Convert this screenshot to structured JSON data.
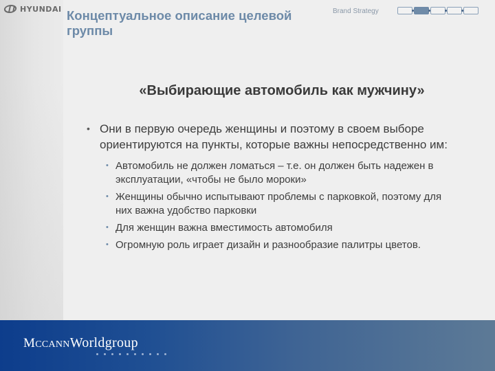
{
  "header": {
    "logo_text": "HYUNDAI",
    "title": "Концептуальное описание целевой группы",
    "brand_label": "Brand Strategy",
    "nav_step_count": 5,
    "nav_active_step": 2
  },
  "main": {
    "heading": "«Выбирающие автомобиль как мужчину»",
    "point": "Они в первую очередь женщины и поэтому в своем выборе ориентируются на пункты, которые важны непосредственно им:",
    "subpoints": [
      "Автомобиль не должен ломаться – т.е. он должен быть надежен в эксплуатации, «чтобы не было мороки»",
      "Женщины обычно испытывают проблемы с парковкой, поэтому для них важна удобство парковки",
      "Для женщин важна вместимость автомобиля",
      "Огромную роль играет дизайн и разнообразие палитры цветов."
    ]
  },
  "footer": {
    "brand_mccann_m": "M",
    "brand_mccann_c": "C",
    "brand_mccann_cann": "CANN",
    "brand_worldgroup": "Worldgroup"
  },
  "colors": {
    "title": "#6d8aa8",
    "footer_start": "#0d3d8c",
    "footer_end": "#5d7a96",
    "text": "#3d3d3d"
  }
}
